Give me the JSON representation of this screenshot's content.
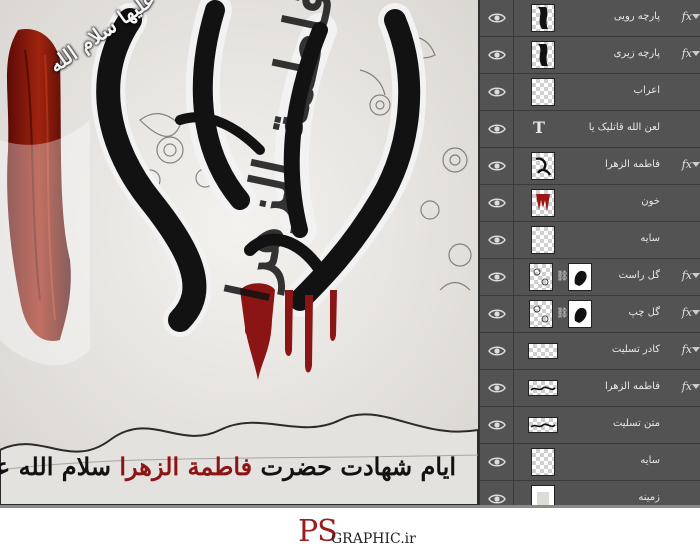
{
  "artwork": {
    "title_calligraphy": "فاطمة الزهرا",
    "honorific": "علیها سلام الله",
    "caption_dark_1": "ایام شهادت حضرت",
    "caption_red": "فاطمة الزهرا",
    "caption_dark_2": "سلام الله علیها"
  },
  "layers": [
    {
      "name": "پارچه رویی",
      "thumb": "shape",
      "fx": true
    },
    {
      "name": "پارچه زیری",
      "thumb": "shape",
      "fx": true
    },
    {
      "name": "اعراب",
      "thumb": "transparent",
      "fx": false
    },
    {
      "name": "لعن الله قاتلیک یا",
      "thumb": "text",
      "fx": false
    },
    {
      "name": "فاطمه الزهرا",
      "thumb": "calligraphy",
      "fx": true
    },
    {
      "name": "خون",
      "thumb": "blood",
      "fx": false
    },
    {
      "name": "سایه",
      "thumb": "transparent",
      "fx": false
    },
    {
      "name": "گل راست",
      "thumb": "masked",
      "fx": true
    },
    {
      "name": "گل چپ",
      "thumb": "masked",
      "fx": true
    },
    {
      "name": "کادر تسلیت",
      "thumb": "transparent",
      "fx": true
    },
    {
      "name": "فاطمه الزهرا",
      "thumb": "calligraphy-wide",
      "fx": true
    },
    {
      "name": "متن تسلیت",
      "thumb": "text-wide",
      "fx": false
    },
    {
      "name": "سایه",
      "thumb": "transparent",
      "fx": false
    },
    {
      "name": "زمینه",
      "thumb": "solid",
      "fx": false
    }
  ],
  "text_layer_icon": "T",
  "fx_label": "fx",
  "icons": {
    "visibility": "eye-icon",
    "link": "chain-icon"
  },
  "colors": {
    "panel": "#535353",
    "canvas_bg": "#e9e7e4",
    "accent_red": "#8b1414",
    "ink": "#121212"
  },
  "footer": {
    "logo_main": "PS",
    "logo_rest": "GRAPHIC.ir"
  }
}
